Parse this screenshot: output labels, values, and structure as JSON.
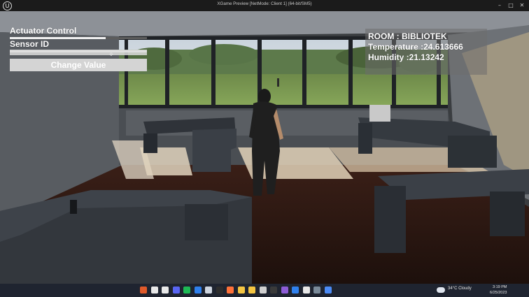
{
  "window": {
    "title": "XGame Preview [NetMode: Client 1]  (64-bit/SM5)",
    "logo_glyph": "U",
    "minimize_glyph": "–",
    "maximize_glyph": "□",
    "close_glyph": "✕"
  },
  "hud": {
    "actuator_label": "Actuator Control",
    "actuator_level": 0.7,
    "sensor_label": "Sensor ID",
    "sensor_level": 1.0,
    "button_label": "Change Value",
    "cursor_glyph": "✥"
  },
  "info": {
    "room": "ROOM : BIBLIOTEK",
    "temperature": "Temperature :24.613666",
    "humidity": "Humidity :21.13242"
  },
  "taskbar": {
    "apps": [
      "ubuntu-icon",
      "unreal-icon",
      "unreal-icon",
      "discord-icon",
      "spotify-icon",
      "vscode-icon",
      "steam-icon",
      "terminal-icon",
      "firefox-icon",
      "files-icon",
      "explorer-icon",
      "unity-icon",
      "terminal-icon",
      "visualstudio-icon",
      "vs-code-icon",
      "unreal-icon",
      "settings-icon",
      "chrome-icon"
    ],
    "app_colors": [
      "#e05a2a",
      "#e8e8e8",
      "#e8e8e8",
      "#5865f2",
      "#1db954",
      "#2f80ed",
      "#cfd6e0",
      "#2d2d2d",
      "#ff7139",
      "#f4c542",
      "#f4c542",
      "#d0d0d0",
      "#3a3a3a",
      "#8d5cd6",
      "#2f80ed",
      "#e8e8e8",
      "#7a8a99",
      "#4c8bf5"
    ],
    "weather": "34°C  Cloudy",
    "time": "3:19 PM",
    "date": "6/25/2023"
  },
  "colors": {
    "accent_white": "#ffffff",
    "panel_gray": "#6e6e6e",
    "taskbar": "#1f2430"
  }
}
